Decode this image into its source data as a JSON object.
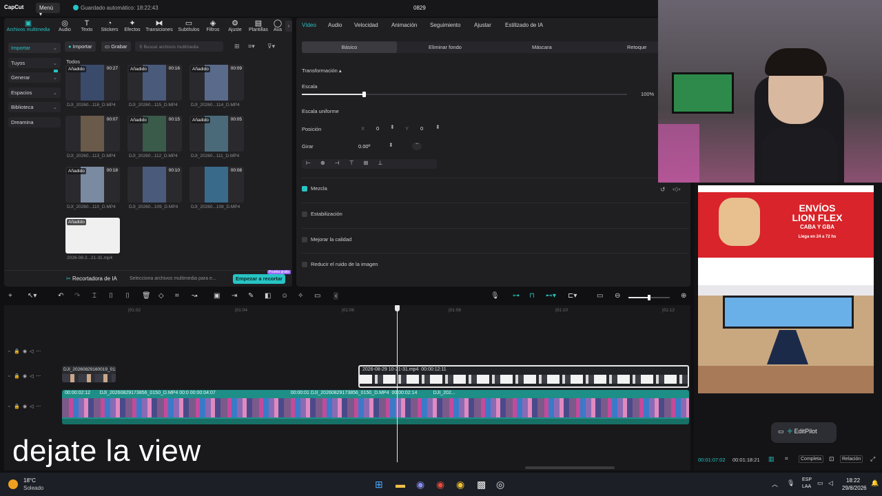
{
  "app": {
    "logo": "CapCut",
    "menu_label": "Menú",
    "autosave": "Guardado automático: 18:22:43",
    "project_title": "0829"
  },
  "media_tabs": [
    {
      "label": "Archivos multimedia",
      "icon": "media-icon"
    },
    {
      "label": "Audio",
      "icon": "audio-icon"
    },
    {
      "label": "Texto",
      "icon": "text-icon"
    },
    {
      "label": "Stickers",
      "icon": "sticker-icon"
    },
    {
      "label": "Efectos",
      "icon": "effects-icon"
    },
    {
      "label": "Transiciones",
      "icon": "transitions-icon"
    },
    {
      "label": "Subtítulos",
      "icon": "subtitles-icon"
    },
    {
      "label": "Filtros",
      "icon": "filters-icon"
    },
    {
      "label": "Ajuste",
      "icon": "adjust-icon"
    },
    {
      "label": "Plantillas",
      "icon": "templates-icon"
    },
    {
      "label": "Ava",
      "icon": "avatar-icon"
    }
  ],
  "sidebar": [
    "Importar",
    "Tuyos",
    "Generar",
    "Espacios",
    "Biblioteca",
    "Dreamina"
  ],
  "media_toolbar": {
    "import_label": "Importar",
    "record_label": "Grabar",
    "search_placeholder": "Buscar archivos multimedia"
  },
  "media_section_label": "Todos",
  "media_items": [
    {
      "name": "DJI_20260...116_D.MP4",
      "duration": "00:27",
      "badge": "Añadido"
    },
    {
      "name": "DJI_20260...115_D.MP4",
      "duration": "00:16",
      "badge": "Añadido"
    },
    {
      "name": "DJI_20260...114_D.MP4",
      "duration": "00:09",
      "badge": "Añadido"
    },
    {
      "name": "DJI_20260...113_D.MP4",
      "duration": "00:07",
      "badge": ""
    },
    {
      "name": "DJI_20260...112_D.MP4",
      "duration": "00:15",
      "badge": "Añadido"
    },
    {
      "name": "DJI_20260...111_D.MP4",
      "duration": "00:05",
      "badge": "Añadido"
    },
    {
      "name": "DJI_20260...110_D.MP4",
      "duration": "00:18",
      "badge": "Añadido"
    },
    {
      "name": "DJI_20260...109_D.MP4",
      "duration": "00:10",
      "badge": ""
    },
    {
      "name": "DJI_20260...108_D.MP4",
      "duration": "00:08",
      "badge": ""
    },
    {
      "name": "2026-08-2...21-31.mp4",
      "duration": "",
      "badge": "Añadido"
    }
  ],
  "ai_cropper": {
    "title": "Recortadora de IA",
    "desc": "Selecciona archivos multimedia para e...",
    "start_label": "Empezar a recortar",
    "free_badge": "Prueba gratis"
  },
  "props_tabs": [
    "Vídeo",
    "Audio",
    "Velocidad",
    "Animación",
    "Seguimiento",
    "Ajustar",
    "Estilizado de IA"
  ],
  "props_subtabs": [
    "Básico",
    "Eliminar fondo",
    "Máscara",
    "Retoque"
  ],
  "transform": {
    "section": "Transformación",
    "scale_label": "Escala",
    "scale_value": "100%",
    "scale_fraction": 0.19,
    "uniform_label": "Escala uniforme",
    "position_label": "Posición",
    "pos_x_label": "X",
    "pos_x": "0",
    "pos_y_label": "Y",
    "pos_y": "0",
    "rotate_label": "Girar",
    "rotate_value": "0.00º"
  },
  "options": [
    {
      "label": "Mezcla",
      "checked": true
    },
    {
      "label": "Estabilización",
      "checked": false
    },
    {
      "label": "Mejorar la calidad",
      "checked": false
    },
    {
      "label": "Reducir el ruido de la imagen",
      "checked": false
    }
  ],
  "ruler": [
    "|01:02",
    "|01:04",
    "|01:06",
    "|01:08",
    "|01:10",
    "|01:12"
  ],
  "clips": {
    "overlay_top_left": "DJI_20260829160019_0112",
    "overlay_main_label": "2026-08-29 10-21-31.mp4",
    "overlay_main_dur": "00:00:12:11",
    "main_track": [
      {
        "label": "00:00:02:12"
      },
      {
        "label": "DJI_20260829173856_0150_D.MP4"
      },
      {
        "label": "00:00:04:07"
      },
      {
        "label": "DJI_20260829173856_0150_D.MP4"
      },
      {
        "label": "00:00:02:14"
      },
      {
        "label": "DJI_202..."
      }
    ],
    "main_track_full": "DJI_20260829173856_0150_D.MP4   00:0",
    "main_track_2": "00:00:01"
  },
  "subtitle_caption": "dejate la view",
  "preview": {
    "editpilot": "EditPilot",
    "current_time": "00:01:07:02",
    "total_time": "00:01:18:21",
    "mode": "Completa",
    "ratio": "Relación"
  },
  "ad": {
    "line1": "ENVÍOS",
    "line2": "LION FLEX",
    "line3": "CABA Y GBA",
    "line4": "Llega en 24 a 72 hs"
  },
  "taskbar": {
    "temp": "18°C",
    "weather": "Soleado",
    "lang1": "ESP",
    "lang2": "LAA",
    "time": "18:22",
    "date": "29/8/2026"
  },
  "colors": {
    "accent": "#27c4c4",
    "clip_main": "#1e8f86",
    "clip_overlay": "#2a9aa6"
  }
}
